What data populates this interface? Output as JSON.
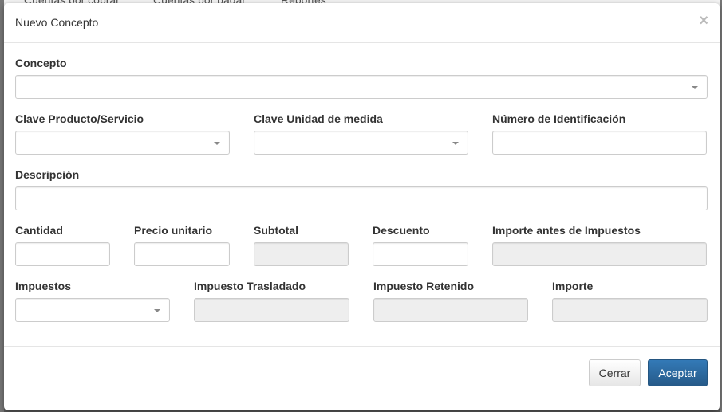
{
  "background": {
    "nav_items": [
      "Cuentas por cobrar",
      "Cuentas por pagar",
      "Reportes"
    ]
  },
  "modal": {
    "title": "Nuevo Concepto",
    "close_icon": "×",
    "fields": {
      "concepto": {
        "label": "Concepto",
        "value": ""
      },
      "clave_producto": {
        "label": "Clave Producto/Servicio",
        "value": ""
      },
      "clave_unidad": {
        "label": "Clave Unidad de medida",
        "value": ""
      },
      "numero_identificacion": {
        "label": "Número de Identificación",
        "value": ""
      },
      "descripcion": {
        "label": "Descripción",
        "value": ""
      },
      "cantidad": {
        "label": "Cantidad",
        "value": ""
      },
      "precio_unitario": {
        "label": "Precio unitario",
        "value": ""
      },
      "subtotal": {
        "label": "Subtotal",
        "value": ""
      },
      "descuento": {
        "label": "Descuento",
        "value": ""
      },
      "importe_antes_impuestos": {
        "label": "Importe antes de Impuestos",
        "value": ""
      },
      "impuestos": {
        "label": "Impuestos",
        "value": ""
      },
      "impuesto_trasladado": {
        "label": "Impuesto Trasladado",
        "value": ""
      },
      "impuesto_retenido": {
        "label": "Impuesto Retenido",
        "value": ""
      },
      "importe": {
        "label": "Importe",
        "value": ""
      }
    },
    "buttons": {
      "cerrar": "Cerrar",
      "aceptar": "Aceptar"
    },
    "colors": {
      "primary": "#337ab7",
      "disabled_bg": "#eeeeee",
      "border": "#cccccc"
    }
  }
}
